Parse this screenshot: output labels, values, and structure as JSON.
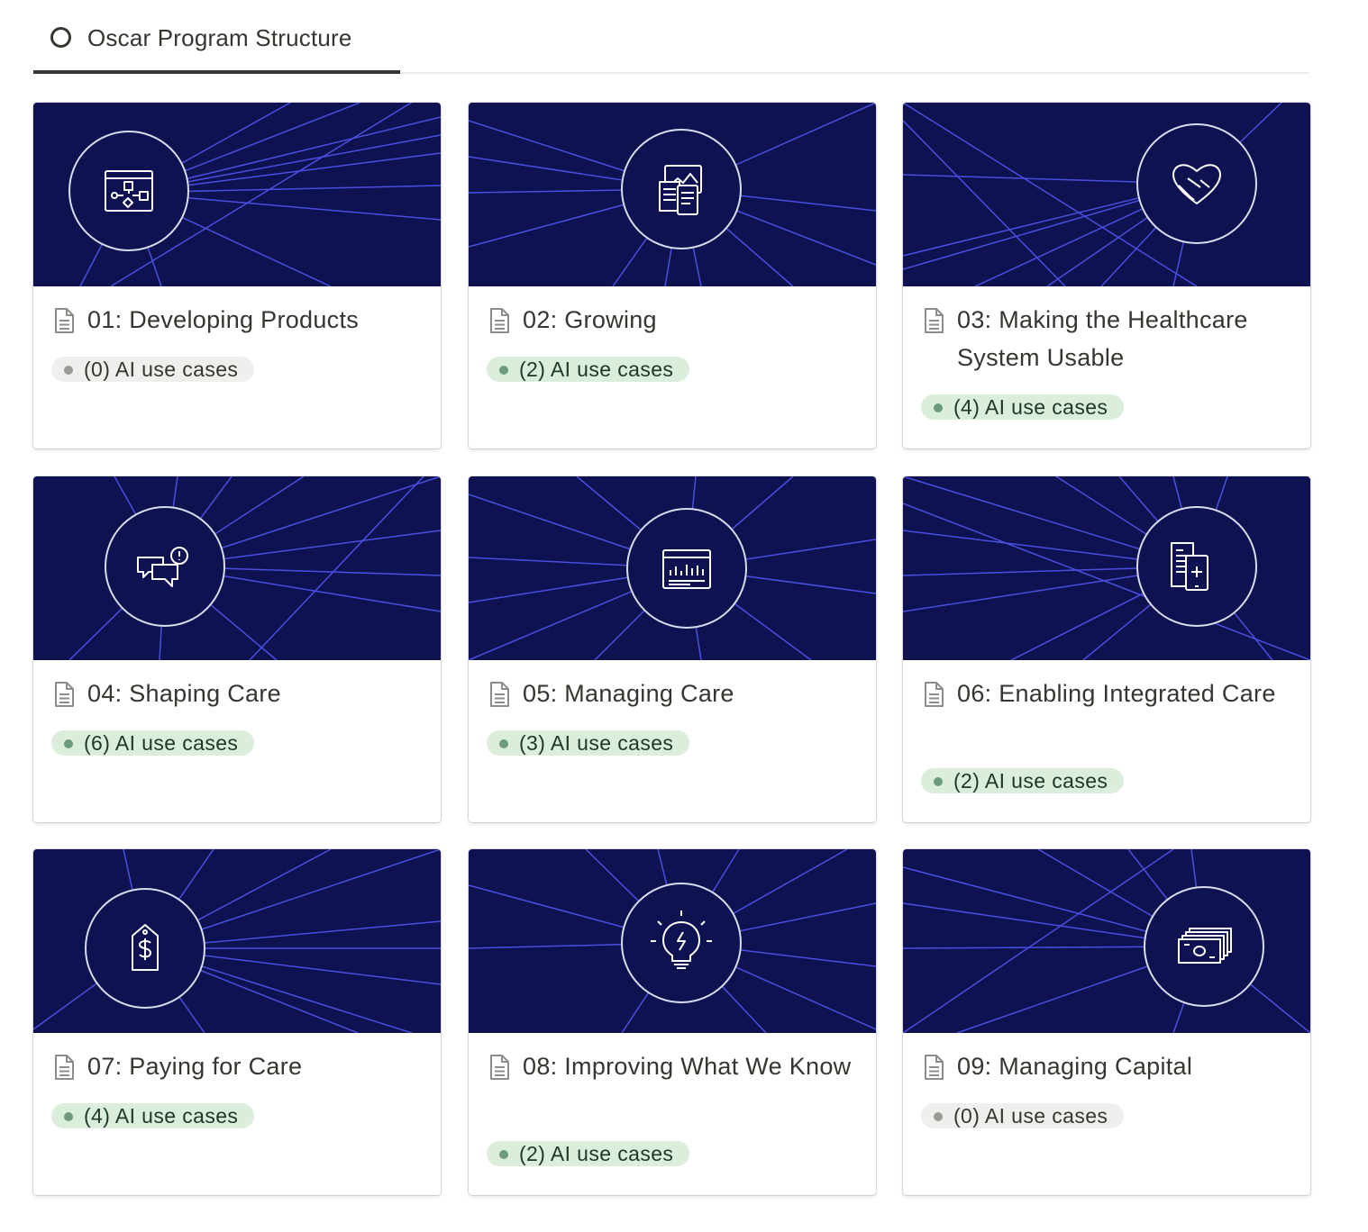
{
  "view": {
    "tab_label": "Oscar Program Structure"
  },
  "cards": [
    {
      "title": "01: Developing Products",
      "tag": "(0) AI use cases",
      "icon": "flowchart-icon",
      "status": "none"
    },
    {
      "title": "02: Growing",
      "tag": "(2) AI use cases",
      "icon": "documents-icon",
      "status": "has"
    },
    {
      "title": "03: Making the Healthcare System Usable",
      "tag": "(4) AI use cases",
      "icon": "handshake-heart-icon",
      "status": "has"
    },
    {
      "title": "04: Shaping Care",
      "tag": "(6) AI use cases",
      "icon": "chat-alert-icon",
      "status": "has"
    },
    {
      "title": "05: Managing Care",
      "tag": "(3) AI use cases",
      "icon": "dashboard-chart-icon",
      "status": "has"
    },
    {
      "title": "06: Enabling Integrated Care",
      "tag": "(2) AI use cases",
      "icon": "medical-record-phone-icon",
      "status": "has"
    },
    {
      "title": "07: Paying for Care",
      "tag": "(4) AI use cases",
      "icon": "price-tag-dollar-icon",
      "status": "has"
    },
    {
      "title": "08: Improving What We Know",
      "tag": "(2) AI use cases",
      "icon": "lightbulb-icon",
      "status": "has"
    },
    {
      "title": "09: Managing Capital",
      "tag": "(0) AI use cases",
      "icon": "cash-stack-icon",
      "status": "none"
    }
  ],
  "colors": {
    "cover_bg": "#0e1250",
    "cover_lines": "#4a4fe0",
    "tag_green_bg": "#dbeddb",
    "tag_gray_bg": "#efefed",
    "text": "#37352f"
  }
}
